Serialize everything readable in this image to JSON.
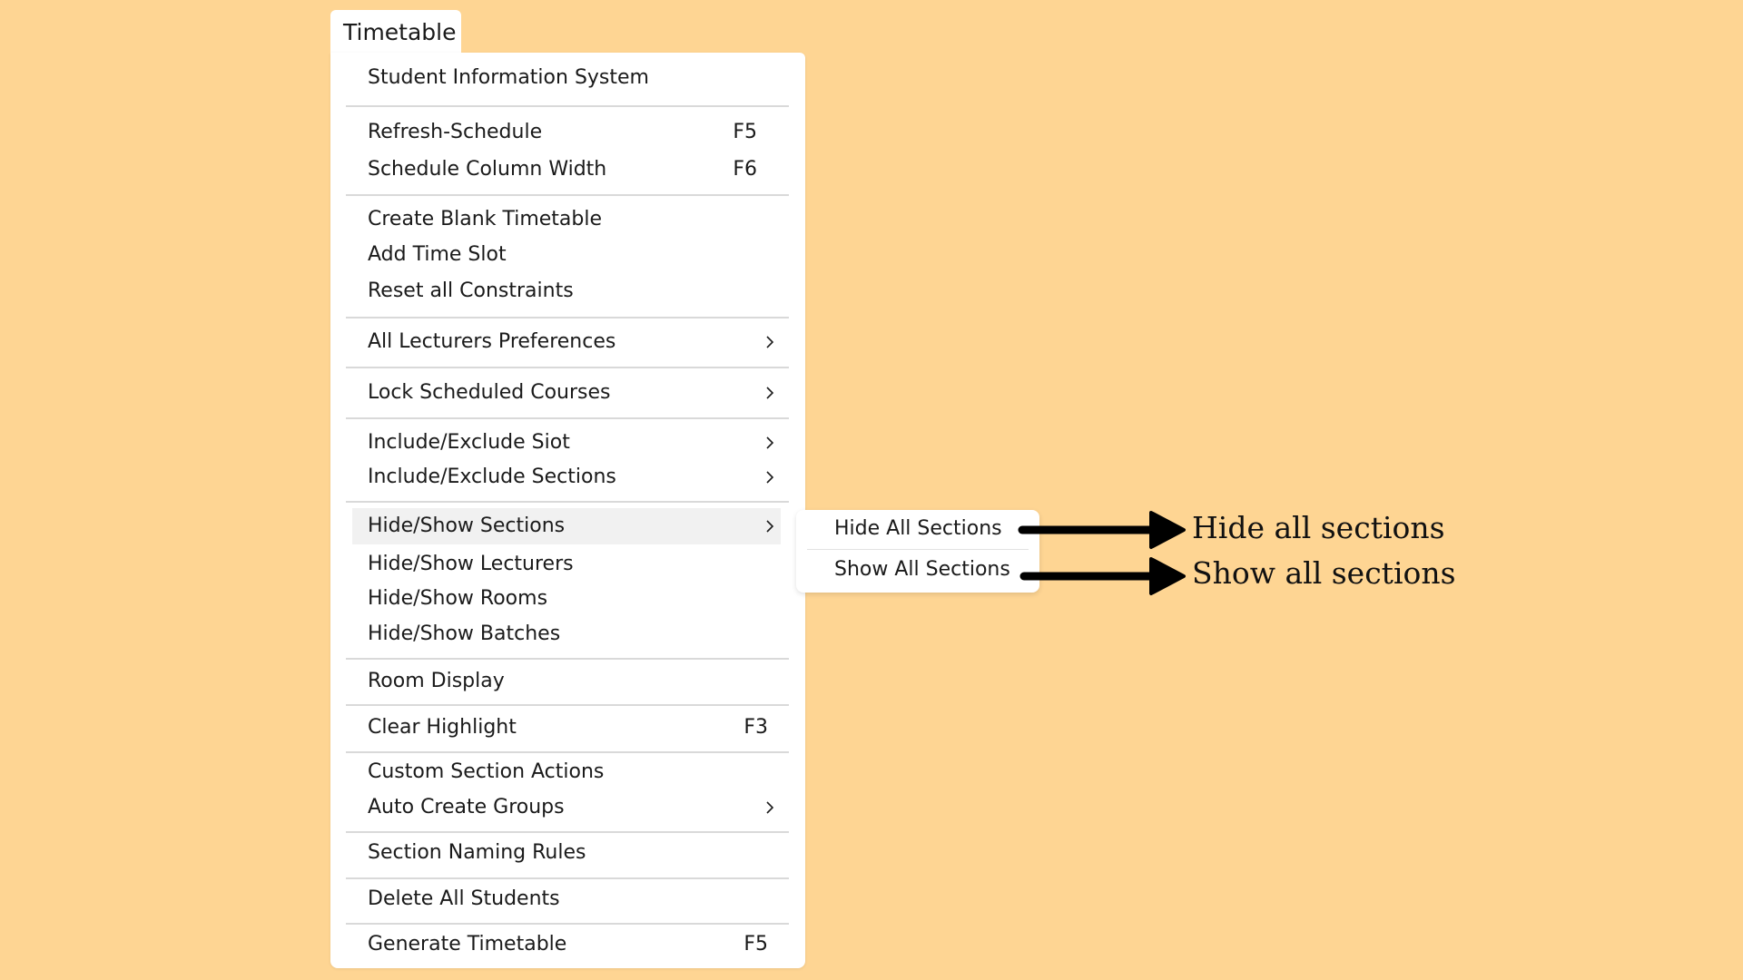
{
  "menu": {
    "title": "Timetable",
    "items": [
      {
        "label": "Student Information System",
        "shortcut": "",
        "submenu": false
      },
      {
        "label": "Refresh-Schedule",
        "shortcut": "F5",
        "submenu": false
      },
      {
        "label": "Schedule Column Width",
        "shortcut": "F6",
        "submenu": false
      },
      {
        "label": "Create Blank Timetable",
        "shortcut": "",
        "submenu": false
      },
      {
        "label": "Add Time Slot",
        "shortcut": "",
        "submenu": false
      },
      {
        "label": "Reset all Constraints",
        "shortcut": "",
        "submenu": false
      },
      {
        "label": "All Lecturers Preferences",
        "shortcut": "",
        "submenu": true
      },
      {
        "label": "Lock Scheduled Courses",
        "shortcut": "",
        "submenu": true
      },
      {
        "label": "Include/Exclude Siot",
        "shortcut": "",
        "submenu": true
      },
      {
        "label": "Include/Exclude Sections",
        "shortcut": "",
        "submenu": true
      },
      {
        "label": "Hide/Show Sections",
        "shortcut": "",
        "submenu": true,
        "highlighted": true
      },
      {
        "label": "Hide/Show Lecturers",
        "shortcut": "",
        "submenu": false
      },
      {
        "label": "Hide/Show Rooms",
        "shortcut": "",
        "submenu": false
      },
      {
        "label": "Hide/Show Batches",
        "shortcut": "",
        "submenu": false
      },
      {
        "label": "Room Display",
        "shortcut": "",
        "submenu": false
      },
      {
        "label": "Clear Highlight",
        "shortcut": "F3",
        "submenu": false
      },
      {
        "label": "Custom Section Actions",
        "shortcut": "",
        "submenu": false
      },
      {
        "label": "Auto Create Groups",
        "shortcut": "",
        "submenu": true
      },
      {
        "label": "Section Naming Rules",
        "shortcut": "",
        "submenu": false
      },
      {
        "label": "Delete All Students",
        "shortcut": "",
        "submenu": false
      },
      {
        "label": "Generate Timetable",
        "shortcut": "F5",
        "submenu": false
      }
    ]
  },
  "submenu": {
    "items": [
      "Hide All Sections",
      "Show All Sections"
    ]
  },
  "callouts": [
    "Hide all sections",
    "Show all sections"
  ],
  "colors": {
    "background": "#FED593",
    "menu": "#FFFFFF",
    "highlight": "#F1F1F1",
    "arrow": "#000000"
  }
}
